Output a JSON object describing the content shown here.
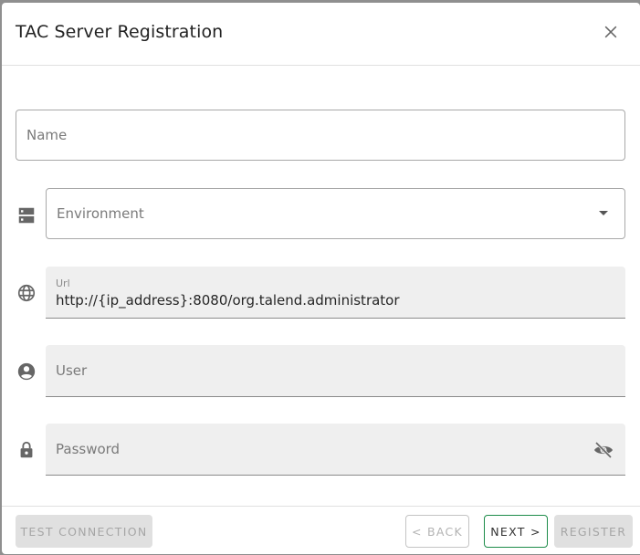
{
  "dialog": {
    "title": "TAC Server Registration",
    "close_icon": "close-icon"
  },
  "form": {
    "name": {
      "placeholder": "Name",
      "value": ""
    },
    "environment": {
      "icon": "server-icon",
      "placeholder": "Environment",
      "selected": "",
      "arrow_icon": "arrow-drop-down-icon"
    },
    "url": {
      "icon": "globe-icon",
      "label": "Url",
      "value": "http://{ip_address}:8080/org.talend.administrator"
    },
    "user": {
      "icon": "account-circle-icon",
      "placeholder": "User",
      "value": ""
    },
    "password": {
      "icon": "lock-icon",
      "placeholder": "Password",
      "value": "",
      "visibility_icon": "visibility-off-icon"
    }
  },
  "footer": {
    "test_connection_label": "TEST CONNECTION",
    "back_label": "< BACK",
    "next_label": "NEXT >",
    "register_label": "REGISTER"
  },
  "colors": {
    "accent": "#1e8c4a",
    "disabled_bg": "#e0e0e0",
    "filled_bg": "#efefef",
    "backdrop": "#8f8f8f"
  }
}
